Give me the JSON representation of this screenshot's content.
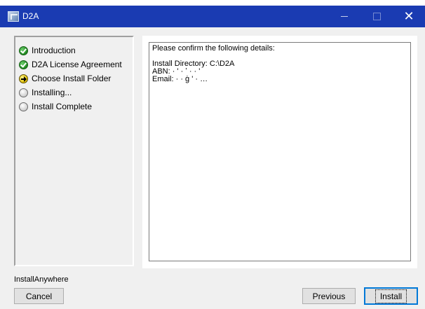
{
  "window": {
    "title": "D2A"
  },
  "steps": [
    {
      "label": "Introduction",
      "status": "complete"
    },
    {
      "label": "D2A License Agreement",
      "status": "complete"
    },
    {
      "label": "Choose Install Folder",
      "status": "current"
    },
    {
      "label": "Installing...",
      "status": "pending"
    },
    {
      "label": "Install Complete",
      "status": "pending"
    }
  ],
  "details": {
    "heading": "Please confirm the following details:",
    "install_directory": "Install Directory: C:\\D2A",
    "abn": "ABN: · ' · ʼ · · '",
    "email": "Email: · · ġ ' · …"
  },
  "footer": {
    "brand": "InstallAnywhere",
    "cancel_label": "Cancel",
    "previous_label": "Previous",
    "install_label": "Install"
  },
  "colors": {
    "titlebar": "#1a3bb2",
    "complete": "#1f8a1f",
    "current": "#e0c000",
    "focus": "#0078d7"
  },
  "icons": {
    "complete": "check-circle-icon",
    "current": "arrow-circle-icon",
    "pending": "empty-circle-icon"
  }
}
